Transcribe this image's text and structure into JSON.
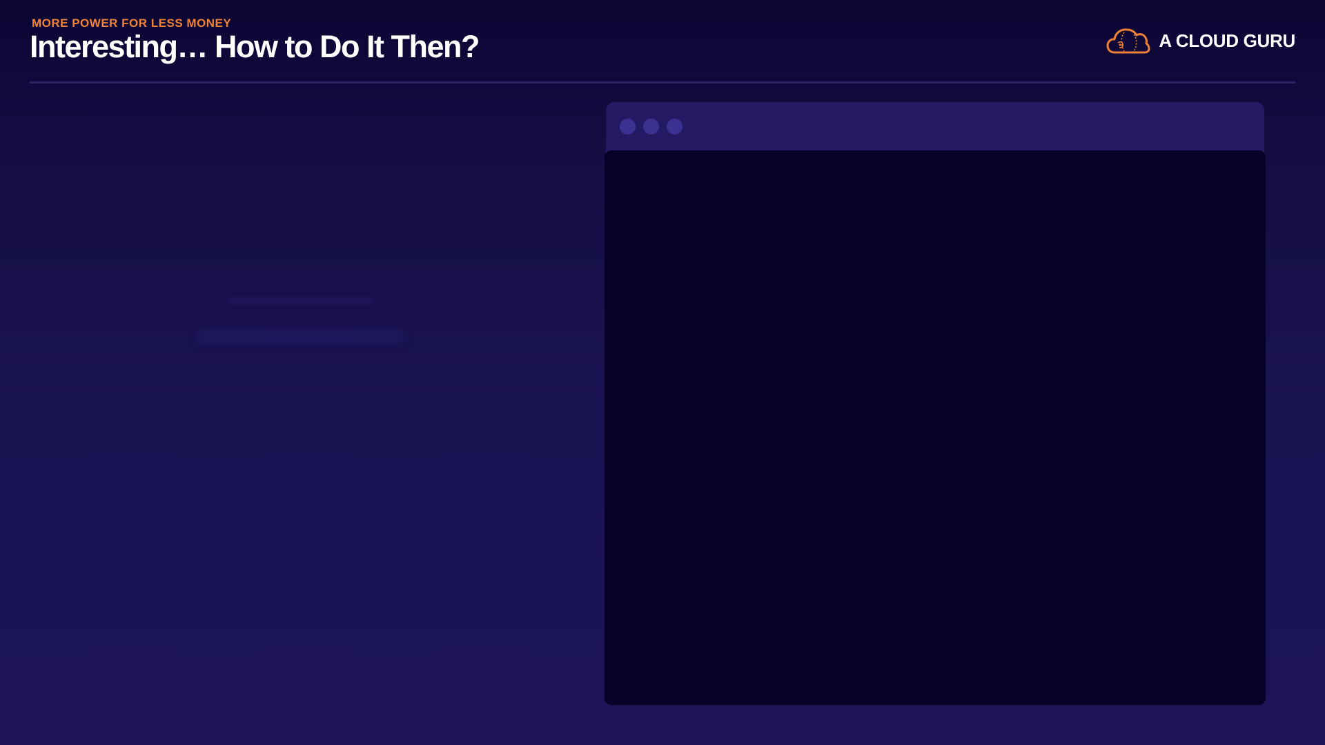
{
  "header": {
    "kicker": "MORE POWER FOR LESS MONEY",
    "title": "Interesting… How to Do It Then?"
  },
  "brand": {
    "name": "A CLOUD GURU",
    "logo_icon": "cloud-logo-icon",
    "accent_color": "#f08235"
  },
  "window": {
    "controls": [
      "window-dot",
      "window-dot",
      "window-dot"
    ],
    "titlebar_color": "#231a63",
    "body_color": "#070129"
  },
  "colors": {
    "background": "#1a1352",
    "text": "#ffffff",
    "accent": "#f08235",
    "divider": "#2a2264"
  }
}
